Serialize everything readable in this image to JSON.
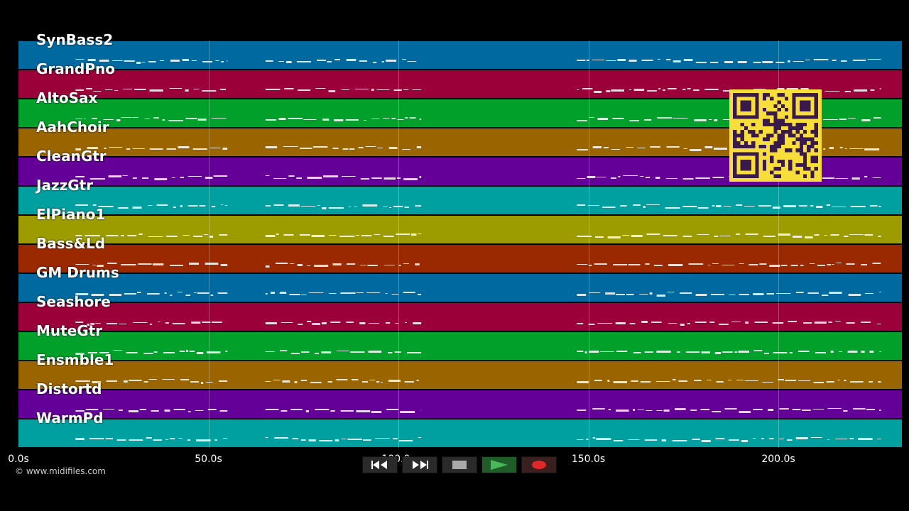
{
  "tracks": [
    {
      "label": "SynBass2",
      "color": "#0069a0"
    },
    {
      "label": "GrandPno",
      "color": "#9b0038"
    },
    {
      "label": "AltoSax",
      "color": "#00a02a"
    },
    {
      "label": "AahChoir",
      "color": "#9a6400"
    },
    {
      "label": "CleanGtr",
      "color": "#640098"
    },
    {
      "label": "JazzGtr",
      "color": "#00a0a0"
    },
    {
      "label": "ElPiano1",
      "color": "#9c9c00"
    },
    {
      "label": "Bass&Ld",
      "color": "#9a2800"
    },
    {
      "label": "GM Drums",
      "color": "#0069a0"
    },
    {
      "label": "Seashore",
      "color": "#9b0038"
    },
    {
      "label": "MuteGtr",
      "color": "#00a02a"
    },
    {
      "label": "Ensmble1",
      "color": "#9a6400"
    },
    {
      "label": "Distortd",
      "color": "#640098"
    },
    {
      "label": "WarmPd",
      "color": "#00a0a0"
    }
  ],
  "timeline": {
    "ticks": [
      "0.0s",
      "50.0s",
      "100.0s",
      "150.0s",
      "200.0s"
    ],
    "tick_values": [
      0,
      50,
      100,
      150,
      200
    ],
    "duration_visible": 232
  },
  "copyright": "© www.midifiles.com",
  "qr": {
    "icon": "qr-code-icon",
    "color": "#f7de3a"
  },
  "transport": {
    "rewind_icon": "rewind-icon",
    "forward_icon": "fast-forward-icon",
    "stop_icon": "stop-icon",
    "play_icon": "play-icon",
    "record_icon": "record-icon"
  }
}
